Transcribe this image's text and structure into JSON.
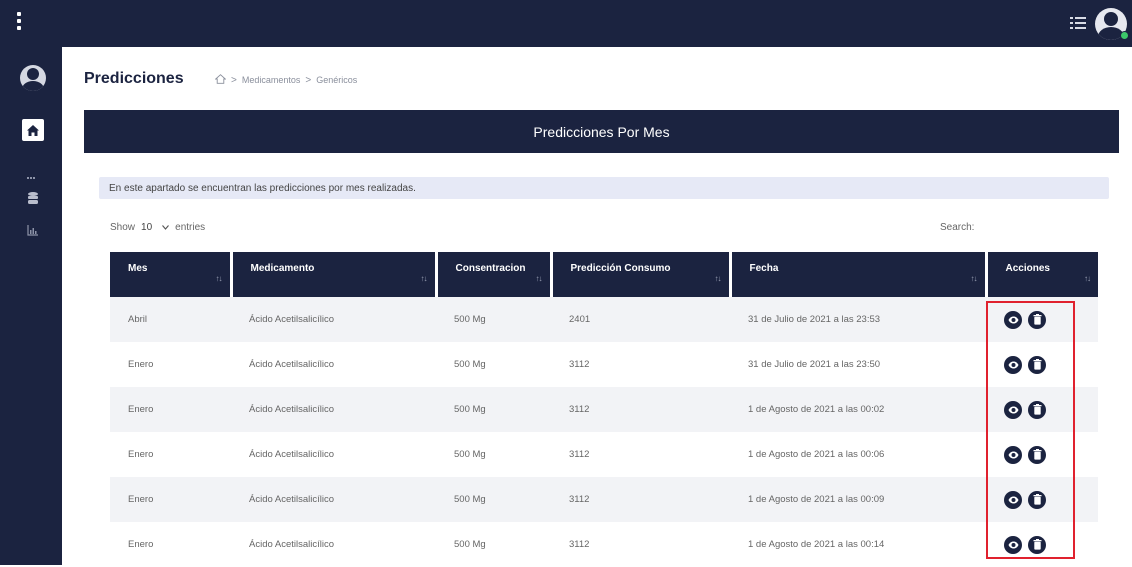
{
  "page": {
    "title": "Predicciones",
    "breadcrumb": [
      "Medicamentos",
      "Genéricos"
    ]
  },
  "panel": {
    "header": "Predicciones Por Mes",
    "info": "En este apartado se encuentran las predicciones por mes realizadas."
  },
  "table_controls": {
    "show_label": "Show",
    "entries_value": "10",
    "entries_label": "entries",
    "search_label": "Search:"
  },
  "table": {
    "columns": [
      "Mes",
      "Medicamento",
      "Consentracion",
      "Predicción Consumo",
      "Fecha",
      "Acciones"
    ],
    "rows": [
      {
        "mes": "Abril",
        "medicamento": "Ácido Acetilsalicílico",
        "concentracion": "500 Mg",
        "prediccion": "2401",
        "fecha": "31 de Julio de 2021 a las 23:53"
      },
      {
        "mes": "Enero",
        "medicamento": "Ácido Acetilsalicílico",
        "concentracion": "500 Mg",
        "prediccion": "3112",
        "fecha": "31 de Julio de 2021 a las 23:50"
      },
      {
        "mes": "Enero",
        "medicamento": "Ácido Acetilsalicílico",
        "concentracion": "500 Mg",
        "prediccion": "3112",
        "fecha": "1 de Agosto de 2021 a las 00:02"
      },
      {
        "mes": "Enero",
        "medicamento": "Ácido Acetilsalicílico",
        "concentracion": "500 Mg",
        "prediccion": "3112",
        "fecha": "1 de Agosto de 2021 a las 00:06"
      },
      {
        "mes": "Enero",
        "medicamento": "Ácido Acetilsalicílico",
        "concentracion": "500 Mg",
        "prediccion": "3112",
        "fecha": "1 de Agosto de 2021 a las 00:09"
      },
      {
        "mes": "Enero",
        "medicamento": "Ácido Acetilsalicílico",
        "concentracion": "500 Mg",
        "prediccion": "3112",
        "fecha": "1 de Agosto de 2021 a las 00:14"
      }
    ]
  },
  "colors": {
    "navy": "#1b2340",
    "highlight": "#e0212e",
    "info_bg": "#e6e9f6",
    "online": "#3cc76a"
  },
  "icons": {
    "menu": "kebab-icon",
    "list": "list-icon",
    "home": "home-icon",
    "database": "database-icon",
    "chart": "bar-chart-icon",
    "view": "eye-icon",
    "delete": "trash-icon"
  }
}
